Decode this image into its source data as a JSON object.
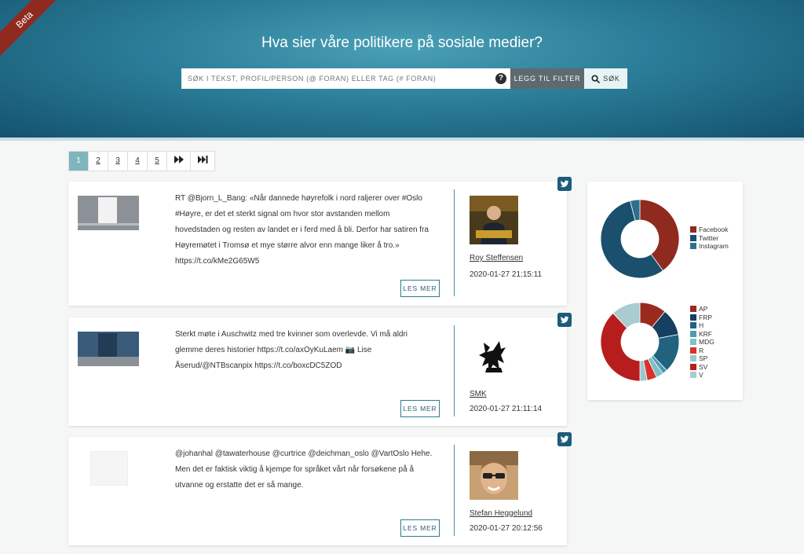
{
  "header": {
    "beta": "Beta",
    "title": "Hva sier våre politikere på sosiale medier?",
    "search_placeholder": "SØK I TEKST, PROFIL/PERSON (@ FORAN) ELLER TAG (# FORAN)",
    "help_glyph": "?",
    "filter_button": "LEGG TIL FILTER",
    "search_button": "SØK"
  },
  "pagination": {
    "pages": [
      "1",
      "2",
      "3",
      "4",
      "5"
    ],
    "next_glyph": "⏩",
    "last_glyph": "⏭"
  },
  "posts": [
    {
      "text": "RT @Bjorn_L_Bang: «Når dannede høyrefolk i nord raljerer over #Oslo #Høyre, er det et sterkt signal om hvor stor avstanden mellom hovedstaden og resten av landet er i ferd med å bli. Derfor har satiren fra Høyremøtet i Tromsø et mye større alvor enn mange liker å tro.» https://t.co/kMe2G65W5",
      "read_more": "LES MER",
      "author": "Roy Steffensen",
      "timestamp": "2020-01-27 21:15:11",
      "network_icon": "twitter-icon"
    },
    {
      "text": "Sterkt møte i Auschwitz med tre kvinner som overlevde. Vi må aldri glemme deres historier https://t.co/axOyKuLaem 📷 Lise Åserud/@NTBscanpix https://t.co/boxcDC5ZOD",
      "read_more": "LES MER",
      "author": "SMK",
      "timestamp": "2020-01-27 21:11:14",
      "network_icon": "twitter-icon"
    },
    {
      "text": "@johanhal @tawaterhouse @curtrice @deichman_oslo @VartOslo Hehe. Men det er faktisk viktig å kjempe for språket vårt når forsøkene på å utvanne og erstatte det er så mange.",
      "read_more": "LES MER",
      "author": "Stefan Heggelund",
      "timestamp": "2020-01-27 20:12:56",
      "network_icon": "twitter-icon"
    }
  ],
  "sidebar": {
    "network_legend": [
      {
        "label": "Facebook",
        "color": "#8f2a1f"
      },
      {
        "label": "Twitter",
        "color": "#1a4f6e"
      },
      {
        "label": "Instagram",
        "color": "#2f6f8e"
      }
    ],
    "party_legend": [
      {
        "label": "AP",
        "color": "#9b2a1e"
      },
      {
        "label": "FRP",
        "color": "#173f5f"
      },
      {
        "label": "H",
        "color": "#20637f"
      },
      {
        "label": "KRF",
        "color": "#4e9aaf"
      },
      {
        "label": "MDG",
        "color": "#7fc1c6"
      },
      {
        "label": "R",
        "color": "#d9312b"
      },
      {
        "label": "SP",
        "color": "#9cc7cd"
      },
      {
        "label": "SV",
        "color": "#b81d1d"
      },
      {
        "label": "V",
        "color": "#a9ccd0"
      }
    ]
  },
  "chart_data": [
    {
      "type": "pie",
      "categories": [
        "Facebook",
        "Twitter",
        "Instagram"
      ],
      "values": [
        40,
        56,
        4
      ]
    },
    {
      "type": "pie",
      "categories": [
        "AP",
        "FRP",
        "H",
        "KRF",
        "MDG",
        "R",
        "SP",
        "SV",
        "V"
      ],
      "values": [
        11,
        11,
        16,
        2,
        3,
        4,
        3,
        38,
        12
      ]
    }
  ]
}
